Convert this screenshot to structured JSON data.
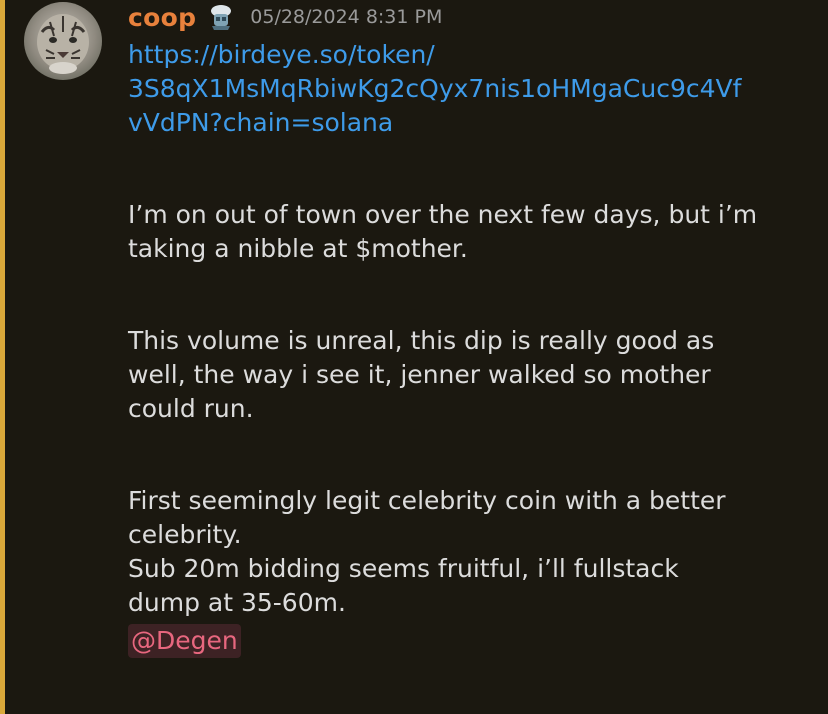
{
  "message": {
    "author": "coop",
    "timestamp": "05/28/2024 8:31 PM",
    "role_icon": "bot-emoji-icon",
    "link_lines": [
      "https://birdeye.so/token/",
      "3S8qX1MsMqRbiwKg2cQyx7nis1oHMgaCuc9c4Vf",
      "vVdPN?chain=solana"
    ],
    "paragraph1": [
      "I’m on out of town over the next few days, but i’m",
      "taking a nibble at $mother."
    ],
    "paragraph2": [
      "This volume is unreal, this dip is really good as",
      "well, the way i see it, jenner walked so mother",
      "could run."
    ],
    "paragraph3": [
      "First seemingly legit celebrity coin with a better",
      "celebrity.",
      "Sub 20m bidding seems fruitful, i’ll fullstack",
      "dump at 35-60m."
    ],
    "mention": "@Degen"
  },
  "colors": {
    "background": "#1b1810",
    "highlight_bar": "#d9a83a",
    "username": "#e8813c",
    "link": "#3e9be9",
    "mention_text": "#e8677f",
    "mention_bg": "#3d2224"
  }
}
